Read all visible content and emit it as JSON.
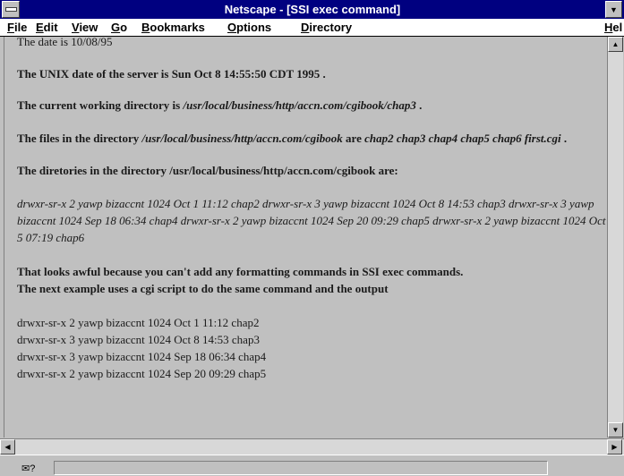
{
  "window": {
    "title": "Netscape - [SSI exec command]",
    "maximize_glyph": "▼"
  },
  "menu": [
    {
      "accel": "F",
      "rest": "ile"
    },
    {
      "accel": "E",
      "rest": "dit"
    },
    {
      "accel": "V",
      "rest": "iew"
    },
    {
      "accel": "G",
      "rest": "o"
    },
    {
      "accel": "B",
      "rest": "ookmarks"
    },
    {
      "accel": "O",
      "rest": "ptions"
    },
    {
      "accel": "D",
      "rest": "irectory"
    },
    {
      "accel": "H",
      "rest": "el"
    }
  ],
  "content": {
    "date_line": "The date is 10/08/95",
    "unix_date": "The UNIX date of the server is Sun Oct 8 14:55:50 CDT 1995 .",
    "cwd_prefix": "The current working directory is ",
    "cwd_path": "/usr/local/business/http/accn.com/cgibook/chap3",
    "cwd_suffix": " .",
    "files_prefix": "The files in the directory ",
    "files_path": "/usr/local/business/http/accn.com/cgibook",
    "files_mid": " are ",
    "files_list": "chap2 chap3 chap4 chap5 chap6 first.cgi",
    "files_suffix": " .",
    "dirs_heading": "The diretories in the directory /usr/local/business/http/accn.com/cgibook are:",
    "dirs_italic": "drwxr-sr-x 2 yawp bizaccnt 1024 Oct 1 11:12 chap2 drwxr-sr-x 3 yawp bizaccnt 1024 Oct 8 14:53 chap3 drwxr-sr-x 3 yawp bizaccnt 1024 Sep 18 06:34 chap4 drwxr-sr-x 2 yawp bizaccnt 1024 Sep 20 09:29 chap5 drwxr-sr-x 2 yawp bizaccnt 1024 Oct 5 07:19 chap6",
    "awful_line1": "That looks awful because you can't add any formatting commands in SSI exec commands.",
    "awful_line2": "The next example uses a cgi script to do the same command and the output",
    "listing": [
      "drwxr-sr-x 2 yawp bizaccnt 1024 Oct 1 11:12 chap2",
      "drwxr-sr-x 3 yawp bizaccnt 1024 Oct 8 14:53 chap3",
      "drwxr-sr-x 3 yawp bizaccnt 1024 Sep 18 06:34 chap4",
      "drwxr-sr-x 2 yawp bizaccnt 1024 Sep 20 09:29 chap5"
    ]
  },
  "scrollbars": {
    "up_glyph": "▲",
    "down_glyph": "▼",
    "left_glyph": "◀",
    "right_glyph": "▶"
  },
  "status": {
    "icon_text": "✉?"
  }
}
